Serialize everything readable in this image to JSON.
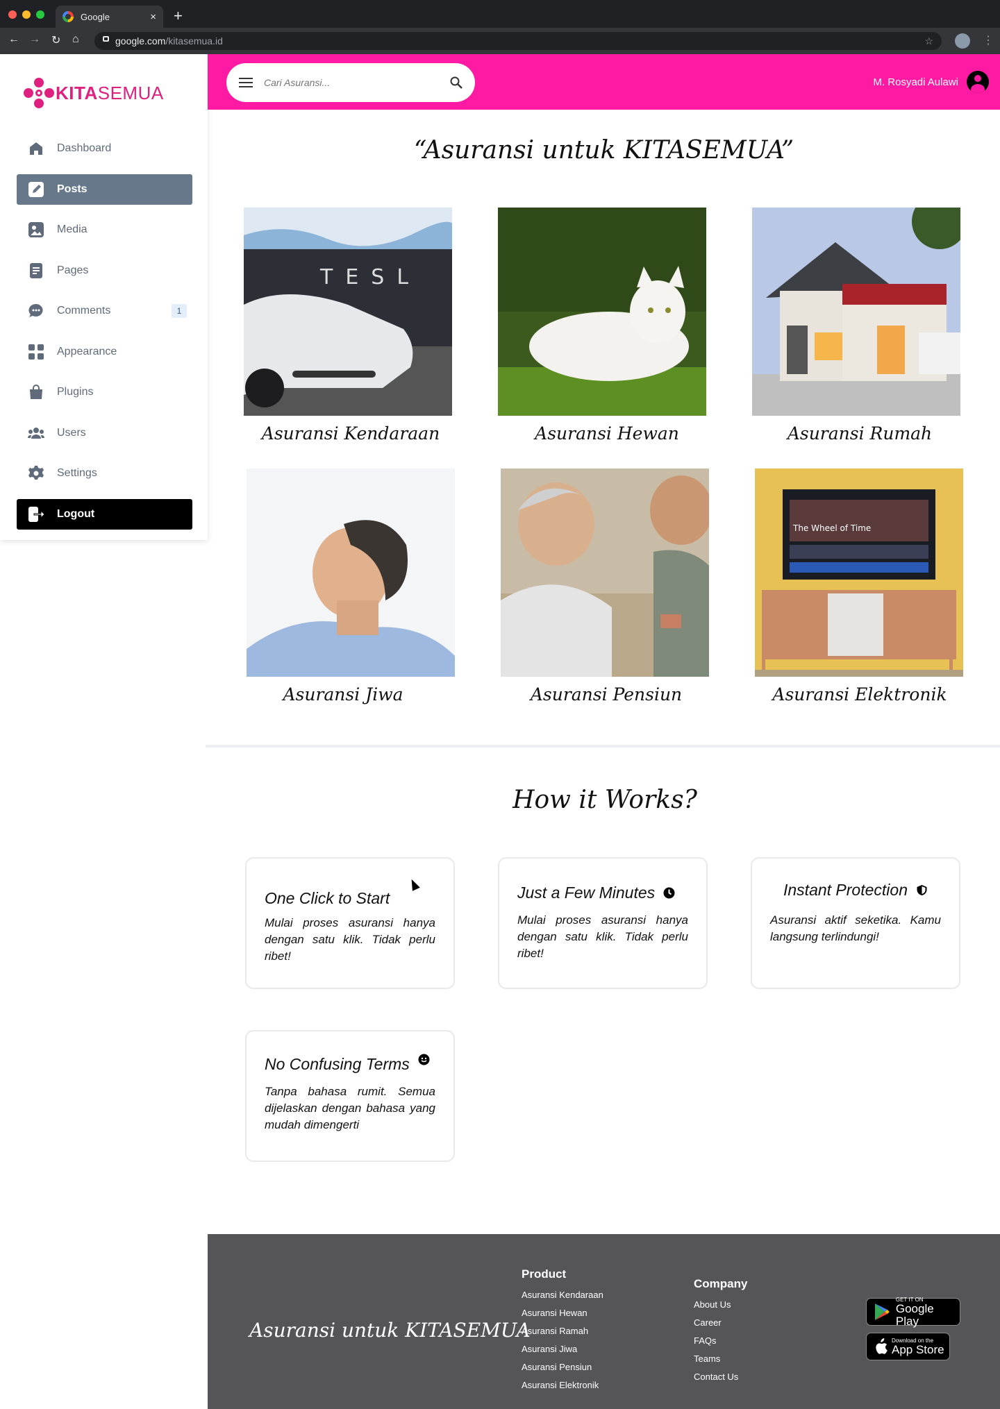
{
  "browser": {
    "tab_title": "Google",
    "url_host": "google.com",
    "url_path": "/kitasemua.id"
  },
  "brand": {
    "name_bold": "KITA",
    "name_light": "SEMUA",
    "accent": "#e0207e"
  },
  "sidebar": {
    "items": [
      {
        "label": "Dashboard",
        "icon": "home-icon"
      },
      {
        "label": "Posts",
        "icon": "edit-icon"
      },
      {
        "label": "Media",
        "icon": "image-icon"
      },
      {
        "label": "Pages",
        "icon": "page-icon"
      },
      {
        "label": "Comments",
        "icon": "comment-icon",
        "badge": "1"
      },
      {
        "label": "Appearance",
        "icon": "grid-icon"
      },
      {
        "label": "Plugins",
        "icon": "bag-icon"
      },
      {
        "label": "Users",
        "icon": "users-icon"
      },
      {
        "label": "Settings",
        "icon": "gear-icon"
      }
    ],
    "logout": "Logout"
  },
  "topbar": {
    "color": "#ff1aa3",
    "search_placeholder": "Cari Asuransi...",
    "user_name": "M. Rosyadi Aulawi"
  },
  "hero": {
    "title": "“Asuransi untuk KITASEMUA”",
    "cards": [
      {
        "caption": "Asuransi Kendaraan"
      },
      {
        "caption": "Asuransi Hewan"
      },
      {
        "caption": "Asuransi Rumah"
      },
      {
        "caption": "Asuransi Jiwa"
      },
      {
        "caption": "Asuransi Pensiun"
      },
      {
        "caption": "Asuransi Elektronik"
      }
    ]
  },
  "how": {
    "title": "How it Works?",
    "steps": [
      {
        "title": "One Click to Start",
        "text": "Mulai proses asuransi hanya dengan satu klik. Tidak perlu ribet!"
      },
      {
        "title": "Just a Few Minutes",
        "text": "Mulai proses asuransi hanya dengan satu klik. Tidak perlu ribet!",
        "icon": "clock-icon"
      },
      {
        "title": "Instant Protection",
        "text": "Asuransi aktif seketika. Kamu langsung terlindungi!",
        "icon": "shield-icon"
      },
      {
        "title": "No Confusing Terms",
        "text": "Tanpa bahasa rumit. Semua dijelaskan dengan bahasa yang mudah dimengerti",
        "icon": "smile-icon"
      }
    ]
  },
  "footer": {
    "tagline": "Asuransi untuk KITASEMUA",
    "product": {
      "heading": "Product",
      "links": [
        "Asuransi Kendaraan",
        "Asuransi Hewan",
        "Asuransi Ramah",
        "Asuransi Jiwa",
        "Asuransi Pensiun",
        "Asuransi Elektronik"
      ]
    },
    "company": {
      "heading": "Company",
      "links": [
        "About Us",
        "Career",
        "FAQs",
        "Teams",
        "Contact Us"
      ]
    },
    "google_play": {
      "small": "GET IT ON",
      "big": "Google Play"
    },
    "app_store": {
      "small": "Download on the",
      "big": "App Store"
    }
  }
}
